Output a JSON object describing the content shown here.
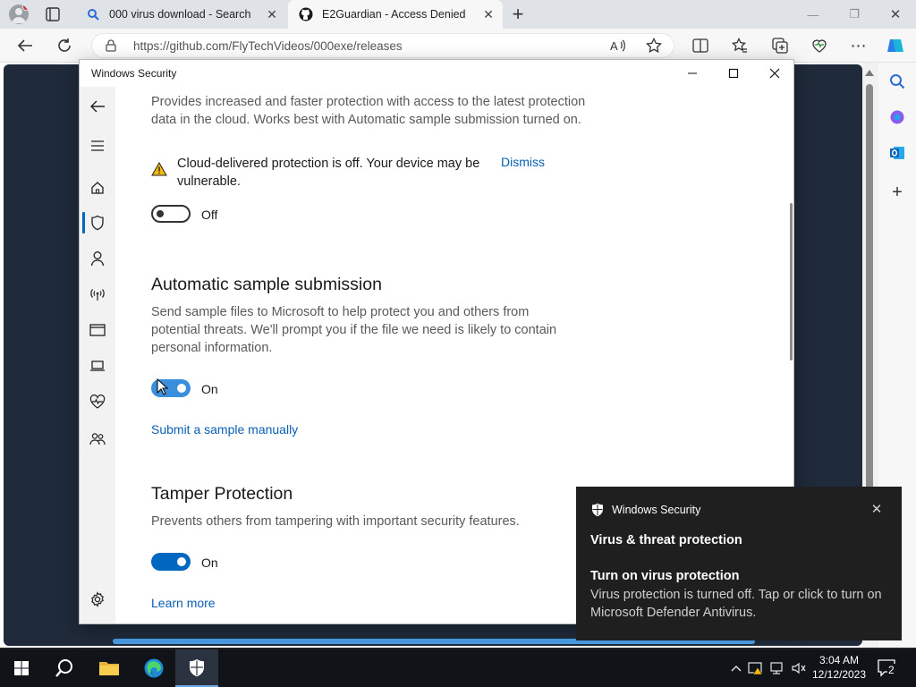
{
  "browser": {
    "tabs": [
      {
        "title": "000 virus download - Search",
        "icon": "search-icon"
      },
      {
        "title": "E2Guardian - Access Denied",
        "icon": "github-icon"
      }
    ],
    "url": "https://github.com/FlyTechVideos/000exe/releases"
  },
  "security_window": {
    "title": "Windows Security",
    "cloud_protection": {
      "description": "Provides increased and faster protection with access to the latest protection data in the cloud. Works best with Automatic sample submission turned on.",
      "warning_text": "Cloud-delivered protection is off. Your device may be vulnerable.",
      "dismiss_label": "Dismiss",
      "toggle_state": "Off"
    },
    "sample_submission": {
      "heading": "Automatic sample submission",
      "description": "Send sample files to Microsoft to help protect you and others from potential threats. We'll prompt you if the file we need is likely to contain personal information.",
      "toggle_state": "On",
      "link": "Submit a sample manually"
    },
    "tamper_protection": {
      "heading": "Tamper Protection",
      "description": "Prevents others from tampering with important security features.",
      "toggle_state": "On",
      "link": "Learn more"
    },
    "nav_icons": [
      "back-icon",
      "menu-icon",
      "home-icon",
      "shield-icon",
      "person-icon",
      "antenna-icon",
      "app-browser-icon",
      "laptop-icon",
      "health-icon",
      "family-icon",
      "gear-icon"
    ]
  },
  "toast": {
    "app_name": "Windows Security",
    "title": "Virus & threat protection",
    "subtitle": "Turn on virus protection",
    "body": "Virus protection is turned off. Tap or click to turn on Microsoft Defender Antivirus."
  },
  "taskbar": {
    "time": "3:04 AM",
    "date": "12/12/2023",
    "notification_count": "2"
  },
  "colors": {
    "accent": "#0067c0",
    "link": "#0a5fb4",
    "toast_bg": "#1f1f1f",
    "taskbar_bg": "#101318"
  }
}
